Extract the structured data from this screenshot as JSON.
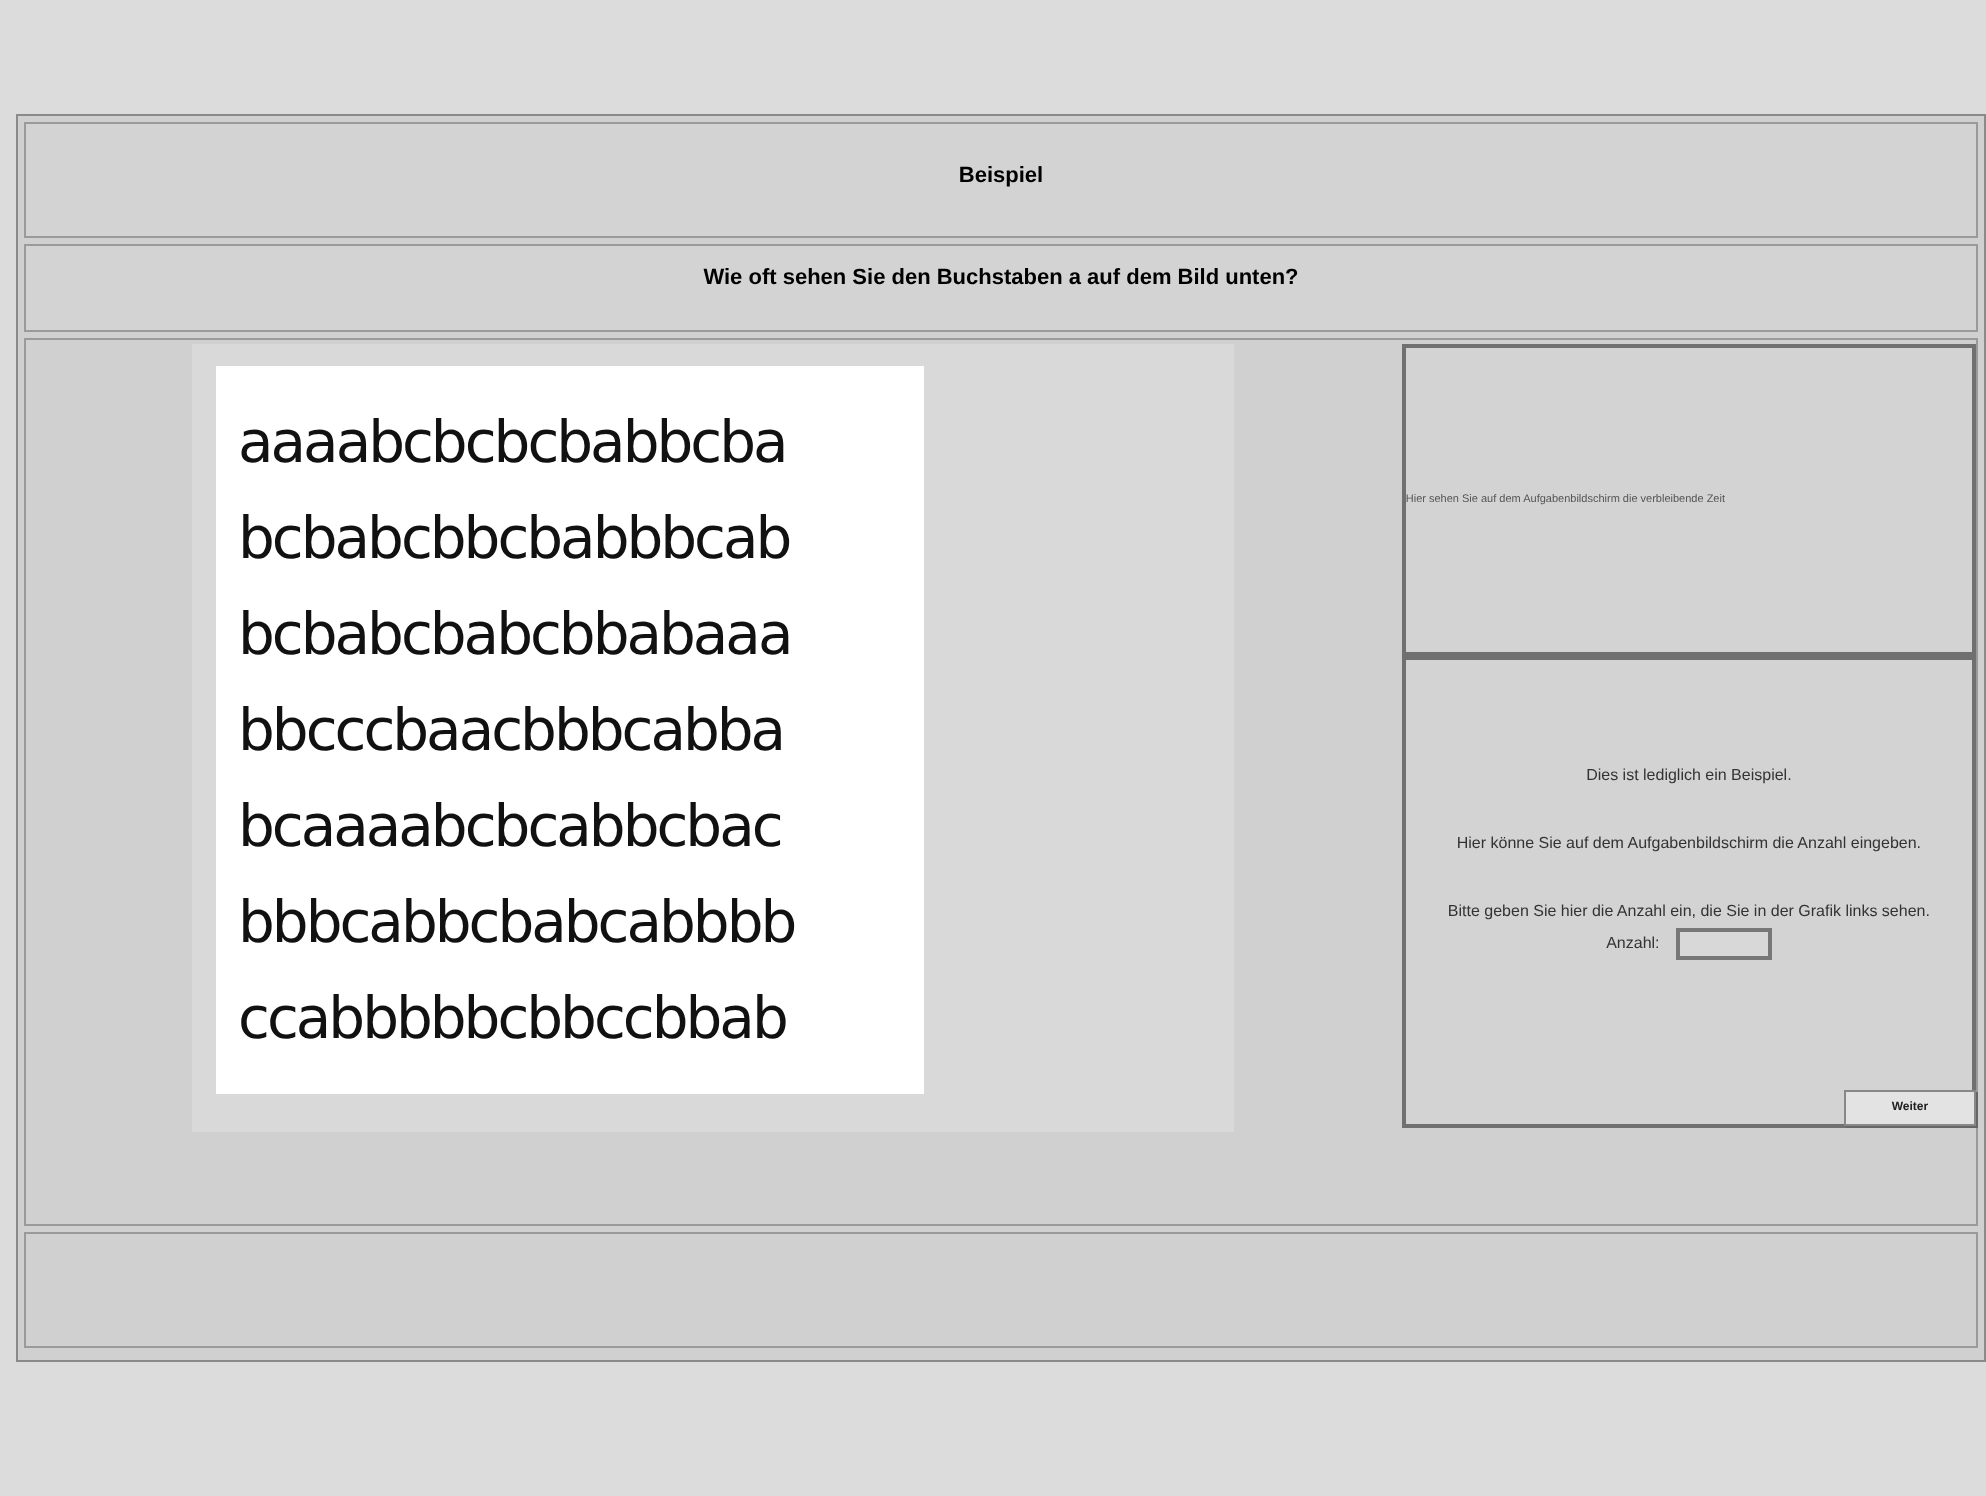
{
  "title": "Beispiel",
  "question": "Wie oft sehen Sie den Buchstaben a auf dem Bild unten?",
  "letter_grid": [
    "aaaabcbcbcbabbcba",
    "bcbabcbbcbabbbcab",
    "bcbabcbabcbbabaaa",
    "bbcccbaacbbbcabba",
    "bcaaaabcbcabbcbac",
    "bbbcabbcbabcabbbb",
    "ccabbbbbcbbccbbab"
  ],
  "timer_panel": {
    "text": "Hier sehen Sie auf dem Aufgabenbildschirm die verbleibende Zeit"
  },
  "input_panel": {
    "lines": [
      "Dies ist lediglich ein Beispiel.",
      "Hier könne Sie auf dem Aufgabenbildschirm die Anzahl eingeben.",
      "Bitte geben Sie hier die Anzahl ein, die Sie in der Grafik links sehen."
    ],
    "field_label": "Anzahl:",
    "button": "Weiter"
  }
}
